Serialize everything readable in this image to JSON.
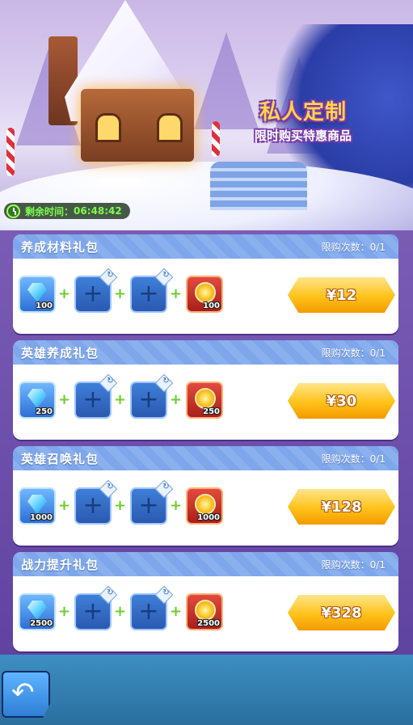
{
  "banner": {
    "title": "私人定制",
    "subtitle": "限时购买特惠商品",
    "timer_label": "剩余时间：",
    "timer_value": "06:48:42"
  },
  "packs": [
    {
      "title": "养成材料礼包",
      "limit": "限购次数：0/1",
      "gem_qty": "100",
      "medal_qty": "100",
      "price": "¥12"
    },
    {
      "title": "英雄养成礼包",
      "limit": "限购次数：0/1",
      "gem_qty": "250",
      "medal_qty": "250",
      "price": "¥30"
    },
    {
      "title": "英雄召唤礼包",
      "limit": "限购次数：0/1",
      "gem_qty": "1000",
      "medal_qty": "1000",
      "price": "¥128"
    },
    {
      "title": "战力提升礼包",
      "limit": "限购次数：0/1",
      "gem_qty": "2500",
      "medal_qty": "2500",
      "price": "¥328"
    }
  ],
  "icons": {
    "gem": "blue-diamond-icon",
    "empty_slot": "plus-icon",
    "refresh": "refresh-icon",
    "medal": "gold-medal-icon",
    "back": "back-arrow-icon"
  },
  "colors": {
    "panel": "#6b4ea5",
    "card_header": "#8bb0ee",
    "price_button": "#ffc21a",
    "timer_text": "#7cff4c",
    "title_gold": "#ffd44a"
  }
}
